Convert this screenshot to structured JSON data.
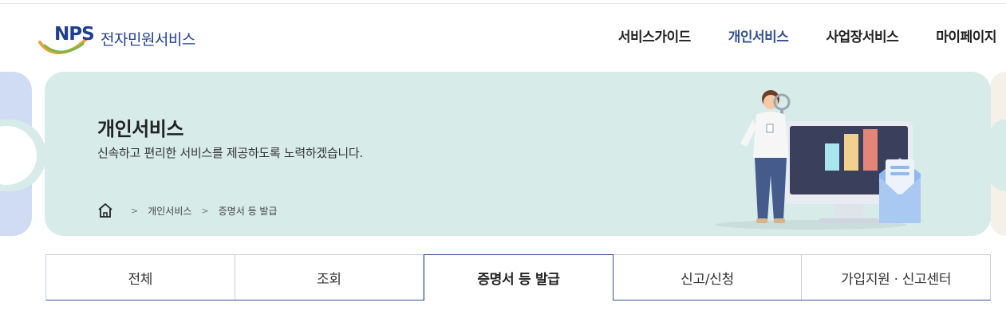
{
  "header": {
    "logo_mark": "NPS",
    "logo_text": "전자민원서비스",
    "nav": [
      {
        "label": "서비스가이드",
        "active": false
      },
      {
        "label": "개인서비스",
        "active": true
      },
      {
        "label": "사업장서비스",
        "active": false
      },
      {
        "label": "마이페이지",
        "active": false
      }
    ]
  },
  "banner": {
    "title": "개인서비스",
    "subtitle": "신속하고 편리한 서비스를 제공하도록 노력하겠습니다.",
    "breadcrumb": [
      "개인서비스",
      "증명서 등 발급"
    ],
    "home_icon": "home-icon"
  },
  "tabs": [
    {
      "label": "전체",
      "active": false
    },
    {
      "label": "조회",
      "active": false
    },
    {
      "label": "증명서 등 발급",
      "active": true
    },
    {
      "label": "신고/신청",
      "active": false
    },
    {
      "label": "가입지원 · 신고센터",
      "active": false
    }
  ],
  "colors": {
    "brand_navy": "#1f3f8f",
    "active_nav": "#35508f",
    "banner_bg": "#d7ebe9"
  }
}
